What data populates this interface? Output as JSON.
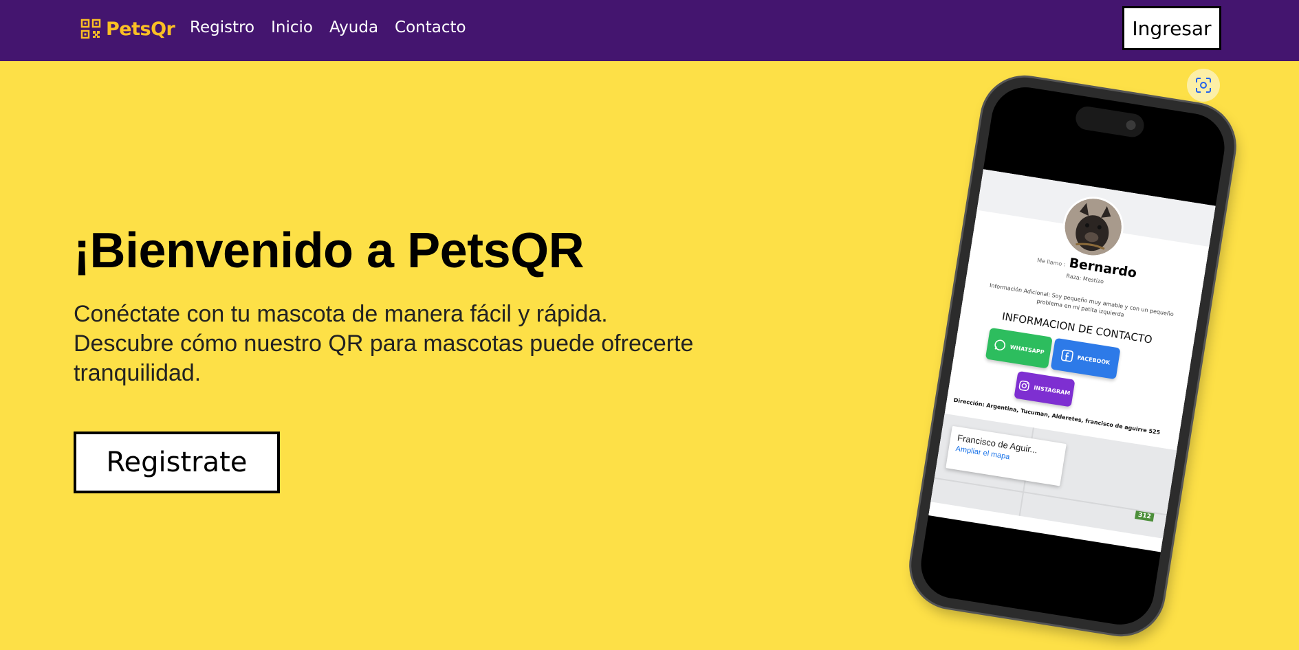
{
  "nav": {
    "brand": "PetsQr",
    "links": [
      "Registro",
      "Inicio",
      "Ayuda",
      "Contacto"
    ],
    "login_label": "Ingresar"
  },
  "hero": {
    "title": "¡Bienvenido a PetsQR",
    "line1": "Conéctate con tu mascota de manera fácil y rápida.",
    "line2": "Descubre cómo nuestro QR para mascotas puede ofrecerte tranquilidad.",
    "register_label": "Registrate"
  },
  "phone_app": {
    "me_llamo": "Me llamo :",
    "pet_name": "Bernardo",
    "breed": "Raza: Mestizo",
    "info": "Información Adicional: Soy pequeño muy amable y con un pequeño problema en mi patita izquierda",
    "contact_title": "INFORMACION DE CONTACTO",
    "whatsapp": "WHATSAPP",
    "facebook": "FACEBOOK",
    "instagram": "INSTAGRAM",
    "address": "Dirección: Argentina, Tucuman, Alderetes, francisco de aguirre 525",
    "map_place": "Francisco de Aguir...",
    "map_link": "Ampliar el mapa",
    "route_number": "312"
  },
  "colors": {
    "nav_bg": "#44156f",
    "page_bg": "#fde047",
    "brand": "#fbbf24"
  }
}
